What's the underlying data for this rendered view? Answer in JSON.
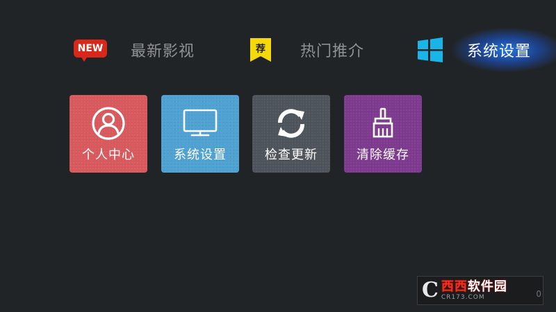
{
  "nav": {
    "items": [
      {
        "label": "最新影视",
        "icon": "new-badge-icon",
        "badge_text": "NEW"
      },
      {
        "label": "热门推介",
        "icon": "recommend-tag-icon",
        "badge_text": "荐"
      },
      {
        "label": "系统设置",
        "icon": "windows-logo-icon",
        "active": true
      }
    ]
  },
  "tiles": [
    {
      "label": "个人中心",
      "icon": "user-profile-icon",
      "color": "#d95a5e"
    },
    {
      "label": "系统设置",
      "icon": "monitor-icon",
      "color": "#4fa2d1"
    },
    {
      "label": "检查更新",
      "icon": "refresh-icon",
      "color": "#4e545b"
    },
    {
      "label": "清除缓存",
      "icon": "broom-icon",
      "color": "#7e3a8e"
    }
  ],
  "watermark": {
    "brand": "西西软件园",
    "brand_red": "西西",
    "brand_white": "软件园",
    "site": "CR173.COM",
    "edge_text": "0"
  },
  "colors": {
    "background": "#212427",
    "nav_inactive": "#8e9195",
    "nav_active": "#ffffff",
    "accent_glow": "#2882ff",
    "new_badge": "#d8281c",
    "tag_yellow": "#f5d90a",
    "windows_icon": "#19b4e8"
  }
}
